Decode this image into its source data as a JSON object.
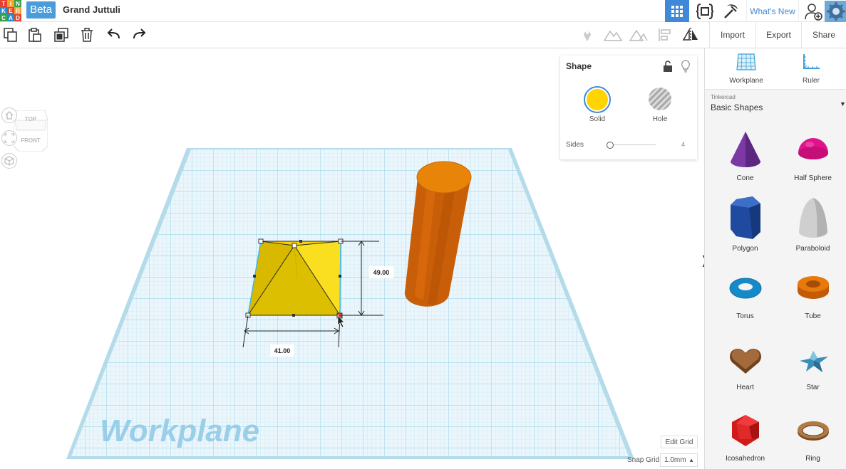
{
  "app": {
    "beta_label": "Beta",
    "project_title": "Grand Juttuli",
    "whats_new": "What's New",
    "logo_letters": [
      "TIN",
      "KER",
      "CAD"
    ]
  },
  "toolbar": {
    "import_label": "Import",
    "export_label": "Export",
    "share_label": "Share"
  },
  "viewcube": {
    "top": "TOP",
    "front": "FRONT"
  },
  "shape_panel": {
    "title": "Shape",
    "solid_label": "Solid",
    "hole_label": "Hole",
    "sides_label": "Sides",
    "sides_value": "4",
    "solid_color": "#ffd400"
  },
  "workplane": {
    "label": "Workplane",
    "width_dim": "41.00",
    "depth_dim": "49.00",
    "edit_grid": "Edit Grid",
    "snap_grid_label": "Snap Grid",
    "snap_grid_value": "1.0mm"
  },
  "sidebar": {
    "workplane_label": "Workplane",
    "ruler_label": "Ruler",
    "library_owner": "Tinkercad",
    "library_name": "Basic Shapes",
    "shapes": [
      {
        "name": "Cone",
        "icon": "cone-icon"
      },
      {
        "name": "Half Sphere",
        "icon": "half-sphere-icon"
      },
      {
        "name": "Polygon",
        "icon": "polygon-icon"
      },
      {
        "name": "Paraboloid",
        "icon": "paraboloid-icon"
      },
      {
        "name": "Torus",
        "icon": "torus-icon"
      },
      {
        "name": "Tube",
        "icon": "tube-icon"
      },
      {
        "name": "Heart",
        "icon": "heart-icon"
      },
      {
        "name": "Star",
        "icon": "star-icon"
      },
      {
        "name": "Icosahedron",
        "icon": "icosahedron-icon"
      },
      {
        "name": "Ring",
        "icon": "ring-icon"
      }
    ]
  },
  "colors": {
    "accent": "#3f89d8",
    "workplane_grid": "#b9e0ef",
    "pyramid": "#f5d000",
    "cylinder": "#d1660a"
  }
}
